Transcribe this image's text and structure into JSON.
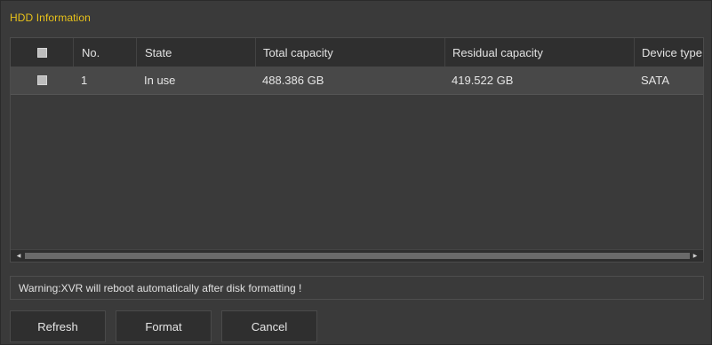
{
  "panel": {
    "title": "HDD Information"
  },
  "table": {
    "headers": {
      "no": "No.",
      "state": "State",
      "total": "Total capacity",
      "residual": "Residual capacity",
      "device": "Device type"
    },
    "rows": [
      {
        "checked": false,
        "no": "1",
        "state": "In use",
        "total": "488.386 GB",
        "residual": "419.522 GB",
        "device": "SATA"
      }
    ]
  },
  "warning": "Warning:XVR will reboot automatically after disk formatting !",
  "buttons": {
    "refresh": "Refresh",
    "format": "Format",
    "cancel": "Cancel"
  },
  "colors": {
    "title_accent": "#e8c21a",
    "background": "#3a3a3a",
    "header_bg": "#2f2f2f",
    "row_bg": "#484848"
  },
  "icons": {
    "scroll_left": "scroll-left-arrow-icon",
    "scroll_right": "scroll-right-arrow-icon",
    "checkbox": "checkbox-icon"
  }
}
